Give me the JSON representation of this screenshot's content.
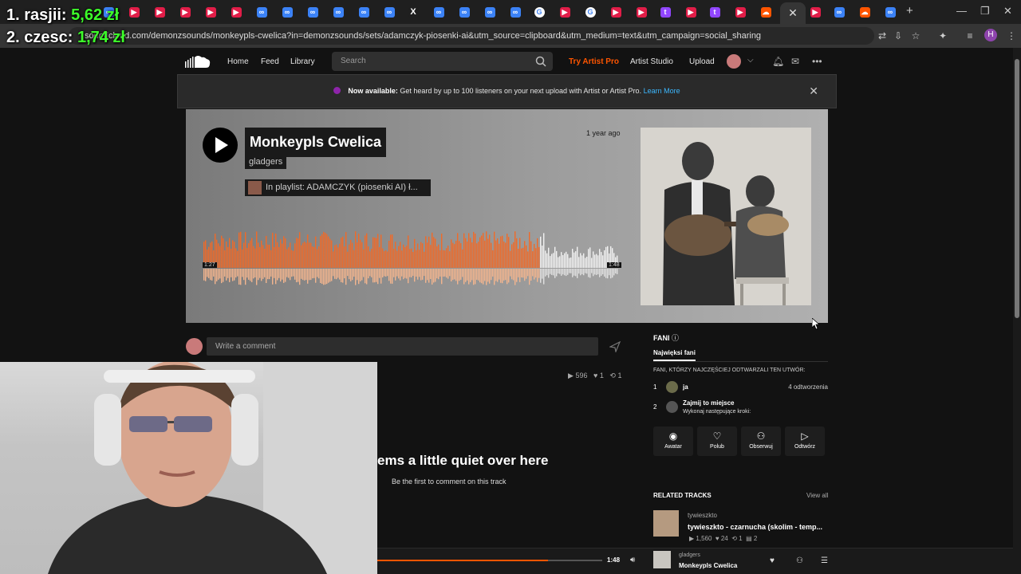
{
  "overlay": {
    "line1_name": "1. rasjii:",
    "line1_value": "5,62 zł",
    "line2_name": "2. czesc:",
    "line2_value": "1,74 zł"
  },
  "browser": {
    "url": "soundcloud.com/demonzsounds/monkeypls-cwelica?in=demonzsounds/sets/adamczyk-piosenki-ai&utm_source=clipboard&utm_medium=text&utm_campaign=social_sharing",
    "profile_initial": "H"
  },
  "nav": {
    "home": "Home",
    "feed": "Feed",
    "library": "Library",
    "search_placeholder": "Search",
    "try_artist_pro": "Try Artist Pro",
    "artist_studio": "Artist Studio",
    "upload": "Upload"
  },
  "banner": {
    "bold": "Now available:",
    "text": "Get heard by up to 100 listeners on your next upload with Artist or Artist Pro.",
    "link": "Learn More"
  },
  "track": {
    "title": "Monkeypls Cwelica",
    "artist": "gladgers",
    "playlist": "In playlist: ADAMCZYK (piosenki AI) ł...",
    "posted": "1 year ago",
    "time_elapsed": "1:27",
    "time_total": "1:48",
    "progress_fraction": 0.81,
    "plays": "596",
    "likes": "1",
    "reposts": "1"
  },
  "comments": {
    "placeholder": "Write a comment",
    "empty_title": "ems a little quiet over here",
    "empty_sub": "Be the first to comment on this track"
  },
  "fans": {
    "heading": "FANI",
    "tab": "Najwięksi fani",
    "subtitle": "FANI, KTÓRZY NAJCZĘŚCIEJ ODTWARZALI TEN UTWÓR:",
    "rows": [
      {
        "num": "1",
        "name": "ja",
        "plays": "4 odtworzenia"
      },
      {
        "num": "2",
        "name": "Zajmij to miejsce",
        "sub": "Wykonaj następujące kroki:"
      }
    ],
    "actions": [
      "Awatar",
      "Polub",
      "Obserwuj",
      "Odtwórz"
    ]
  },
  "related": {
    "heading": "RELATED TRACKS",
    "view_all": "View all",
    "artist": "tywieszkto",
    "title": "tywieszkto - czarnucha (skolim - temp...",
    "plays": "1,560",
    "likes": "24",
    "reposts": "1",
    "comments": "2"
  },
  "player": {
    "time": "1:48",
    "artist": "gladgers",
    "title": "Monkeypls Cwelica",
    "progress_fraction": 0.76
  },
  "colors": {
    "accent": "#ff5500",
    "overlay_value": "#3dff2a",
    "link": "#3db8ff"
  }
}
